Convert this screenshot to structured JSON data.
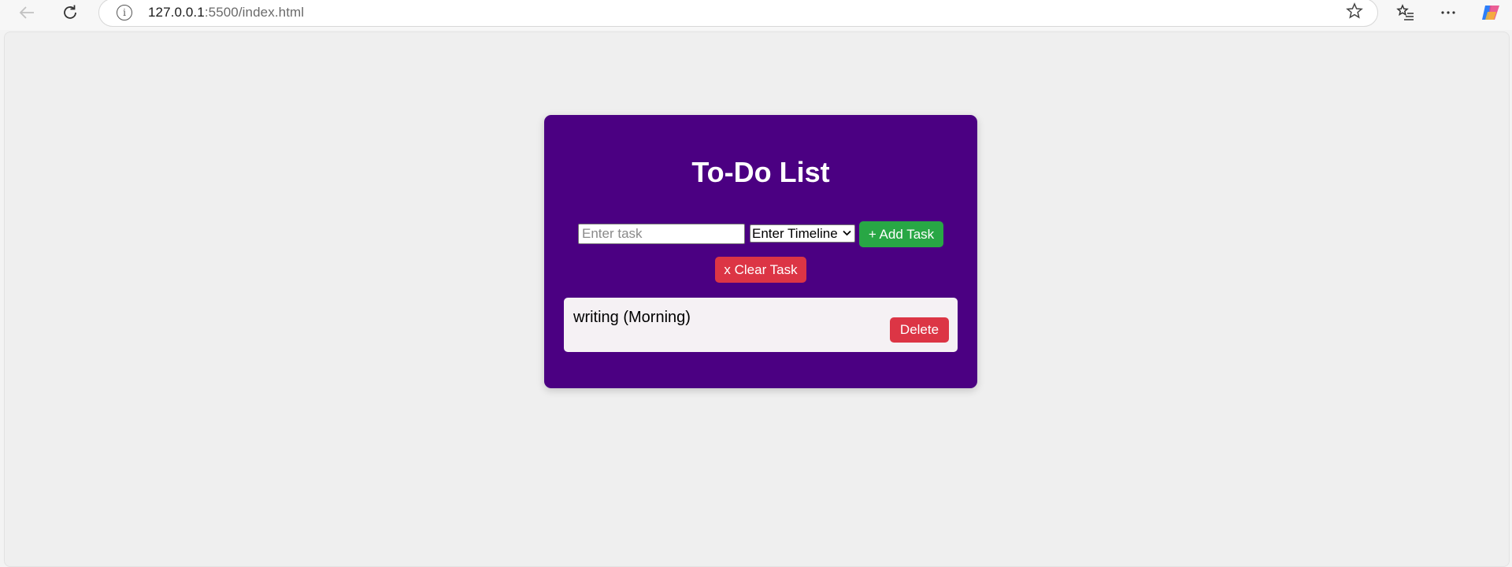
{
  "browser": {
    "url_host": "127.0.0.1",
    "url_rest": ":5500/index.html",
    "icons": {
      "back": "arrow-left",
      "reload": "reload",
      "info": "info",
      "favorite": "star",
      "favorites": "favorites-list",
      "menu": "ellipsis",
      "copilot": "copilot-logo"
    }
  },
  "app": {
    "title": "To-Do List",
    "task_input": {
      "value": "",
      "placeholder": "Enter task"
    },
    "timeline_select": {
      "selected": "Enter Timeline"
    },
    "add_button": "+ Add Task",
    "clear_button": "x Clear Task",
    "tasks": [
      {
        "text": "writing (Morning)",
        "delete_label": "Delete"
      }
    ],
    "colors": {
      "card": "#4b0082",
      "add": "#28a745",
      "danger": "#dc3545"
    }
  }
}
